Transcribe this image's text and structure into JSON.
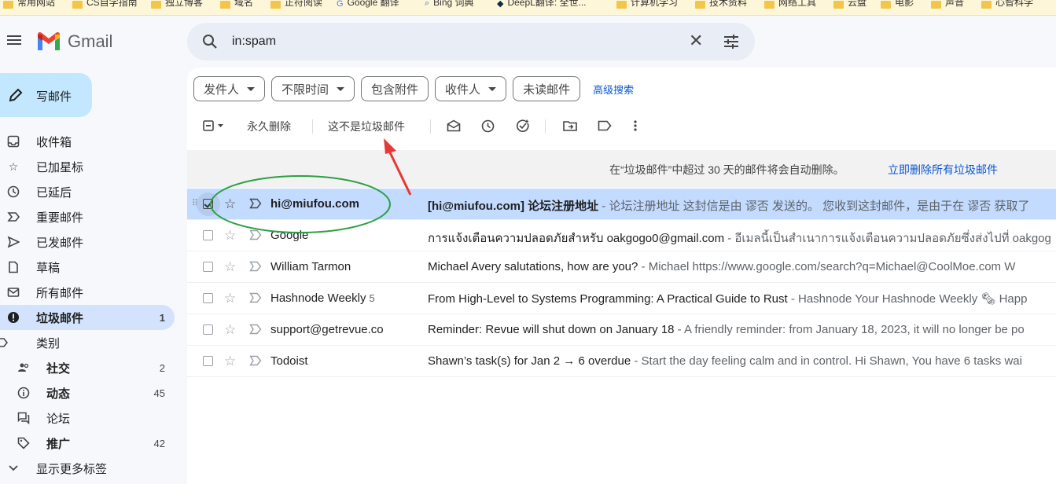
{
  "bookmarks": [
    {
      "label": "常用网站",
      "icon": "folder-icon"
    },
    {
      "label": "CS自学指南",
      "icon": "folder-icon"
    },
    {
      "label": "独立博客",
      "icon": "folder-icon"
    },
    {
      "label": "域名",
      "icon": "folder-icon"
    },
    {
      "label": "正符阅读",
      "icon": "folder-icon"
    },
    {
      "label": "Google 翻译",
      "icon": "google-translate-icon"
    },
    {
      "label": "Bing 词典",
      "icon": "search-icon"
    },
    {
      "label": "DeepL翻译: 全世...",
      "icon": "deepl-icon"
    },
    {
      "label": "计算机学习",
      "icon": "folder-icon"
    },
    {
      "label": "技术资料",
      "icon": "folder-icon"
    },
    {
      "label": "网络工具",
      "icon": "folder-icon"
    },
    {
      "label": "云盘",
      "icon": "folder-icon"
    },
    {
      "label": "电影",
      "icon": "folder-icon"
    },
    {
      "label": "声音",
      "icon": "folder-icon"
    },
    {
      "label": "心智科学",
      "icon": "folder-icon"
    }
  ],
  "app": {
    "name": "Gmail"
  },
  "search": {
    "value": "in:spam"
  },
  "compose": {
    "label": "写邮件"
  },
  "nav": [
    {
      "label": "收件箱",
      "icon": "inbox-icon",
      "count": ""
    },
    {
      "label": "已加星标",
      "icon": "star-icon",
      "count": ""
    },
    {
      "label": "已延后",
      "icon": "clock-icon",
      "count": ""
    },
    {
      "label": "重要邮件",
      "icon": "important-icon",
      "count": ""
    },
    {
      "label": "已发邮件",
      "icon": "send-icon",
      "count": ""
    },
    {
      "label": "草稿",
      "icon": "draft-icon",
      "count": ""
    },
    {
      "label": "所有邮件",
      "icon": "all-mail-icon",
      "count": ""
    },
    {
      "label": "垃圾邮件",
      "icon": "spam-icon",
      "count": "1"
    },
    {
      "label": "类别",
      "icon": "label-icon",
      "count": ""
    },
    {
      "label": "社交",
      "icon": "people-icon",
      "count": "2"
    },
    {
      "label": "动态",
      "icon": "info-icon",
      "count": "45"
    },
    {
      "label": "论坛",
      "icon": "forum-icon",
      "count": ""
    },
    {
      "label": "推广",
      "icon": "tag-icon",
      "count": "42"
    },
    {
      "label": "显示更多标签",
      "icon": "chevron-down-icon",
      "count": ""
    }
  ],
  "filters": {
    "chips": [
      "发件人",
      "不限时间",
      "包含附件",
      "收件人",
      "未读邮件"
    ],
    "advanced": "高级搜索"
  },
  "toolbar": {
    "delete_forever": "永久删除",
    "not_spam": "这不是垃圾邮件"
  },
  "notice": {
    "text": "在“垃圾邮件”中超过 30 天的邮件将会自动删除。",
    "link": "立即删除所有垃圾邮件"
  },
  "emails": [
    {
      "sender": "hi@miufou.com",
      "count": "",
      "subject": "[hi@miufou.com] 论坛注册地址",
      "snippet": " - 论坛注册地址 这封信是由 谬否 发送的。 您收到这封邮件，是由于在 谬否 获取了",
      "selected": true
    },
    {
      "sender": "Google",
      "count": "",
      "subject": "การแจ้งเตือนความปลอดภัยสำหรับ oakgogo0@gmail.com",
      "snippet": " - อีเมลนี้เป็นสำเนาการแจ้งเตือนความปลอดภัยซึ่งส่งไปที่ oakgog",
      "selected": false
    },
    {
      "sender": "William Tarmon",
      "count": "",
      "subject": "Michael Avery salutations, how are you?",
      "snippet": " - Michael https://www.google.com/search?q=Michael@CoolMoe.com W",
      "selected": false
    },
    {
      "sender": "Hashnode Weekly",
      "count": "5",
      "subject": "From High-Level to Systems Programming: A Practical Guide to Rust",
      "snippet": " - Hashnode Your Hashnode Weekly 🗞 Happ",
      "selected": false
    },
    {
      "sender": "support@getrevue.co",
      "count": "",
      "subject": "Reminder: Revue will shut down on January 18",
      "snippet": " - A friendly reminder: from January 18, 2023, it will no longer be po",
      "selected": false
    },
    {
      "sender": "Todoist",
      "count": "",
      "subject": "Shawn’s task(s) for Jan 2 → 6 overdue",
      "snippet": " - Start the day feeling calm and in control. Hi Shawn, You have 6 tasks wai",
      "selected": false
    }
  ],
  "colors": {
    "accent": "#0b57d0",
    "selected_row": "#c2dbff",
    "annotation_arrow": "#e53935",
    "annotation_ellipse": "#2ea043"
  }
}
